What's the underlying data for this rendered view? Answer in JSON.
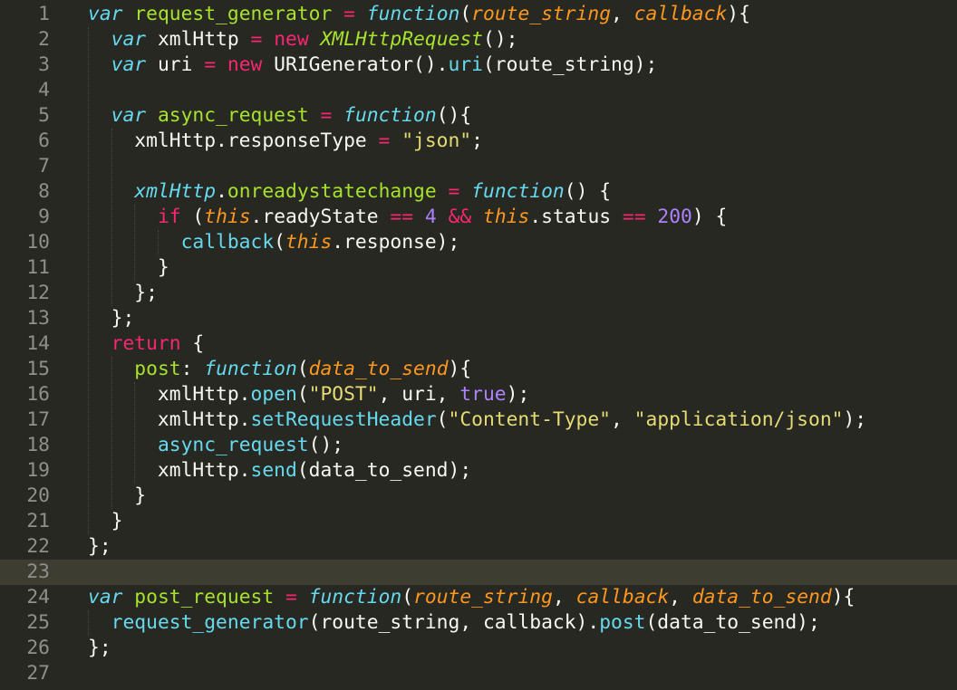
{
  "editor": {
    "theme_colors": {
      "background": "#272822",
      "current_line": "#3E3D32",
      "line_number": "#8F908A",
      "keyword": "#F92672",
      "storage": "#66D9EF",
      "function_name": "#A6E22E",
      "parameter": "#FD971F",
      "string": "#E6DB74",
      "number": "#AE81FF",
      "plain": "#F8F8F2"
    },
    "current_line_number": 23,
    "lines": [
      {
        "n": "1",
        "tokens": [
          [
            "kw-storage",
            "var"
          ],
          [
            "plain",
            " "
          ],
          [
            "fname",
            "request_generator"
          ],
          [
            "plain",
            " "
          ],
          [
            "op",
            "="
          ],
          [
            "plain",
            " "
          ],
          [
            "fkw",
            "function"
          ],
          [
            "plain",
            "("
          ],
          [
            "param",
            "route_string"
          ],
          [
            "plain",
            ", "
          ],
          [
            "param",
            "callback"
          ],
          [
            "plain",
            "){"
          ]
        ]
      },
      {
        "n": "2",
        "tokens": [
          [
            "plain",
            "  "
          ],
          [
            "kw-storage",
            "var"
          ],
          [
            "plain",
            " xmlHttp "
          ],
          [
            "op",
            "="
          ],
          [
            "plain",
            " "
          ],
          [
            "kw",
            "new"
          ],
          [
            "plain",
            " "
          ],
          [
            "cls",
            "XMLHttpRequest"
          ],
          [
            "plain",
            "();"
          ]
        ]
      },
      {
        "n": "3",
        "tokens": [
          [
            "plain",
            "  "
          ],
          [
            "kw-storage",
            "var"
          ],
          [
            "plain",
            " uri "
          ],
          [
            "op",
            "="
          ],
          [
            "plain",
            " "
          ],
          [
            "kw",
            "new"
          ],
          [
            "plain",
            " URIGenerator()."
          ],
          [
            "method",
            "uri"
          ],
          [
            "plain",
            "(route_string);"
          ]
        ]
      },
      {
        "n": "4",
        "tokens": []
      },
      {
        "n": "5",
        "tokens": [
          [
            "plain",
            "  "
          ],
          [
            "kw-storage",
            "var"
          ],
          [
            "plain",
            " "
          ],
          [
            "fname",
            "async_request"
          ],
          [
            "plain",
            " "
          ],
          [
            "op",
            "="
          ],
          [
            "plain",
            " "
          ],
          [
            "fkw",
            "function"
          ],
          [
            "plain",
            "(){"
          ]
        ]
      },
      {
        "n": "6",
        "tokens": [
          [
            "plain",
            "    xmlHttp.responseType "
          ],
          [
            "op",
            "="
          ],
          [
            "plain",
            " "
          ],
          [
            "str",
            "\"json\""
          ],
          [
            "plain",
            ";"
          ]
        ]
      },
      {
        "n": "7",
        "tokens": []
      },
      {
        "n": "8",
        "tokens": [
          [
            "plain",
            "    "
          ],
          [
            "propi",
            "xmlHttp"
          ],
          [
            "plain",
            "."
          ],
          [
            "prop",
            "onreadystatechange"
          ],
          [
            "plain",
            " "
          ],
          [
            "op",
            "="
          ],
          [
            "plain",
            " "
          ],
          [
            "fkw",
            "function"
          ],
          [
            "plain",
            "() {"
          ]
        ]
      },
      {
        "n": "9",
        "tokens": [
          [
            "plain",
            "      "
          ],
          [
            "kw",
            "if"
          ],
          [
            "plain",
            " ("
          ],
          [
            "this",
            "this"
          ],
          [
            "plain",
            ".readyState "
          ],
          [
            "op",
            "=="
          ],
          [
            "plain",
            " "
          ],
          [
            "num",
            "4"
          ],
          [
            "plain",
            " "
          ],
          [
            "op",
            "&&"
          ],
          [
            "plain",
            " "
          ],
          [
            "this",
            "this"
          ],
          [
            "plain",
            ".status "
          ],
          [
            "op",
            "=="
          ],
          [
            "plain",
            " "
          ],
          [
            "num",
            "200"
          ],
          [
            "plain",
            ") {"
          ]
        ]
      },
      {
        "n": "10",
        "tokens": [
          [
            "plain",
            "        "
          ],
          [
            "method",
            "callback"
          ],
          [
            "plain",
            "("
          ],
          [
            "this",
            "this"
          ],
          [
            "plain",
            ".response);"
          ]
        ]
      },
      {
        "n": "11",
        "tokens": [
          [
            "plain",
            "      }"
          ]
        ]
      },
      {
        "n": "12",
        "tokens": [
          [
            "plain",
            "    };"
          ]
        ]
      },
      {
        "n": "13",
        "tokens": [
          [
            "plain",
            "  };"
          ]
        ]
      },
      {
        "n": "14",
        "tokens": [
          [
            "plain",
            "  "
          ],
          [
            "kw",
            "return"
          ],
          [
            "plain",
            " {"
          ]
        ]
      },
      {
        "n": "15",
        "tokens": [
          [
            "plain",
            "    "
          ],
          [
            "fname",
            "post"
          ],
          [
            "plain",
            ": "
          ],
          [
            "fkw",
            "function"
          ],
          [
            "plain",
            "("
          ],
          [
            "param",
            "data_to_send"
          ],
          [
            "plain",
            "){"
          ]
        ]
      },
      {
        "n": "16",
        "tokens": [
          [
            "plain",
            "      xmlHttp."
          ],
          [
            "method",
            "open"
          ],
          [
            "plain",
            "("
          ],
          [
            "str",
            "\"POST\""
          ],
          [
            "plain",
            ", uri, "
          ],
          [
            "num",
            "true"
          ],
          [
            "plain",
            ");"
          ]
        ]
      },
      {
        "n": "17",
        "tokens": [
          [
            "plain",
            "      xmlHttp."
          ],
          [
            "method",
            "setRequestHeader"
          ],
          [
            "plain",
            "("
          ],
          [
            "str",
            "\"Content-Type\""
          ],
          [
            "plain",
            ", "
          ],
          [
            "str",
            "\"application/json\""
          ],
          [
            "plain",
            ");"
          ]
        ]
      },
      {
        "n": "18",
        "tokens": [
          [
            "plain",
            "      "
          ],
          [
            "method",
            "async_request"
          ],
          [
            "plain",
            "();"
          ]
        ]
      },
      {
        "n": "19",
        "tokens": [
          [
            "plain",
            "      xmlHttp."
          ],
          [
            "method",
            "send"
          ],
          [
            "plain",
            "(data_to_send);"
          ]
        ]
      },
      {
        "n": "20",
        "tokens": [
          [
            "plain",
            "    }"
          ]
        ]
      },
      {
        "n": "21",
        "tokens": [
          [
            "plain",
            "  }"
          ]
        ]
      },
      {
        "n": "22",
        "tokens": [
          [
            "plain",
            "};"
          ]
        ]
      },
      {
        "n": "23",
        "tokens": []
      },
      {
        "n": "24",
        "tokens": [
          [
            "kw-storage",
            "var"
          ],
          [
            "plain",
            " "
          ],
          [
            "fname",
            "post_request"
          ],
          [
            "plain",
            " "
          ],
          [
            "op",
            "="
          ],
          [
            "plain",
            " "
          ],
          [
            "fkw",
            "function"
          ],
          [
            "plain",
            "("
          ],
          [
            "param",
            "route_string"
          ],
          [
            "plain",
            ", "
          ],
          [
            "param",
            "callback"
          ],
          [
            "plain",
            ", "
          ],
          [
            "param",
            "data_to_send"
          ],
          [
            "plain",
            "){"
          ]
        ]
      },
      {
        "n": "25",
        "tokens": [
          [
            "plain",
            "  "
          ],
          [
            "method",
            "request_generator"
          ],
          [
            "plain",
            "(route_string, callback)."
          ],
          [
            "method",
            "post"
          ],
          [
            "plain",
            "(data_to_send);"
          ]
        ]
      },
      {
        "n": "26",
        "tokens": [
          [
            "plain",
            "};"
          ]
        ]
      },
      {
        "n": "27",
        "tokens": []
      }
    ]
  }
}
